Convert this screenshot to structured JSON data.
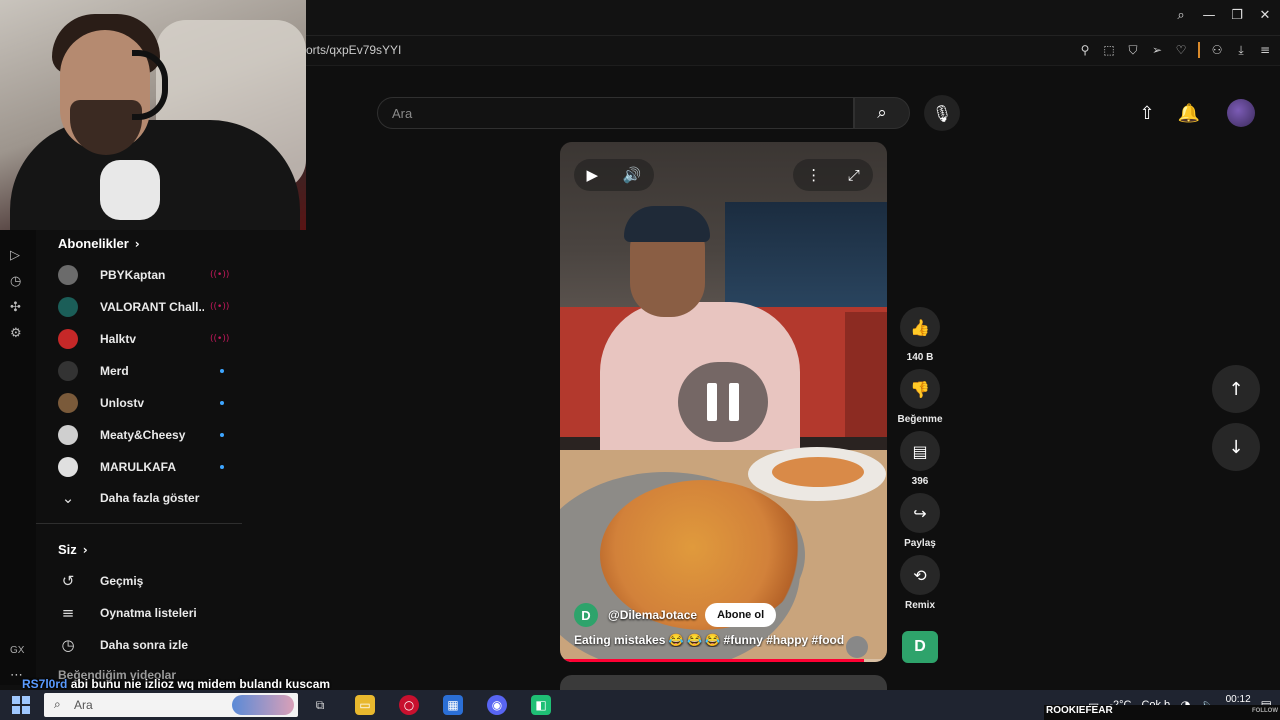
{
  "browser": {
    "url": "orts/qxpEv79sYYI",
    "window_controls": [
      "search-icon",
      "minimize-icon",
      "restore-icon",
      "close-icon"
    ],
    "extension_icons": [
      "pin-icon",
      "screenshot-icon",
      "shield-icon",
      "send-icon",
      "heart-icon",
      "account-icon",
      "download-icon",
      "menu-icon"
    ]
  },
  "header": {
    "search_placeholder": "Ara"
  },
  "sidebar": {
    "subscriptions_title": "Abonelikler",
    "subscriptions": [
      {
        "name": "PBYKaptan",
        "status": "live",
        "avatar_color": "#6b6b6b"
      },
      {
        "name": "VALORANT Chall...",
        "status": "live",
        "avatar_color": "#1b5e58"
      },
      {
        "name": "Halktv",
        "status": "live",
        "avatar_color": "#c62828"
      },
      {
        "name": "Merd",
        "status": "new",
        "avatar_color": "#333333"
      },
      {
        "name": "Unlostv",
        "status": "new",
        "avatar_color": "#7a5a3a"
      },
      {
        "name": "Meaty&Cheesy",
        "status": "new",
        "avatar_color": "#cfcfcf"
      },
      {
        "name": "MARULKAFA",
        "status": "new",
        "avatar_color": "#e0e0e0"
      }
    ],
    "show_more": "Daha fazla göster",
    "you_title": "Siz",
    "you_items": [
      {
        "label": "Geçmiş",
        "icon": "history-icon"
      },
      {
        "label": "Oynatma listeleri",
        "icon": "playlist-icon"
      },
      {
        "label": "Daha sonra izle",
        "icon": "clock-icon"
      },
      {
        "label": "Beğendiğim videolar",
        "icon": "like-icon"
      }
    ]
  },
  "short": {
    "channel_initial": "D",
    "channel": "@DilemaJotace",
    "subscribe": "Abone ol",
    "caption": "Eating mistakes 😂 😂 😂 #funny #happy #food",
    "progress": 0.93,
    "likes": "140 B",
    "dislike_label": "Beğenme",
    "comments": "396",
    "share_label": "Paylaş",
    "remix_label": "Remix",
    "channel_square_initial": "D"
  },
  "chat": {
    "user": "RS7l0rd",
    "message": "abi bunu nie izlioz wq midem bulandı kuscam"
  },
  "rail": {
    "gx_label": "GX"
  },
  "taskbar": {
    "search_placeholder": "Ara",
    "temperature": "-2°C",
    "weather": "Çok b",
    "time": "00:12",
    "streamer": "ROOKIEFEAR",
    "follow": "FOLLOW"
  },
  "colors": {
    "accent_red": "#ff0033",
    "live_pink": "#c2185b",
    "new_dot_blue": "#3ea6ff",
    "channel_green": "#2ea36b"
  }
}
